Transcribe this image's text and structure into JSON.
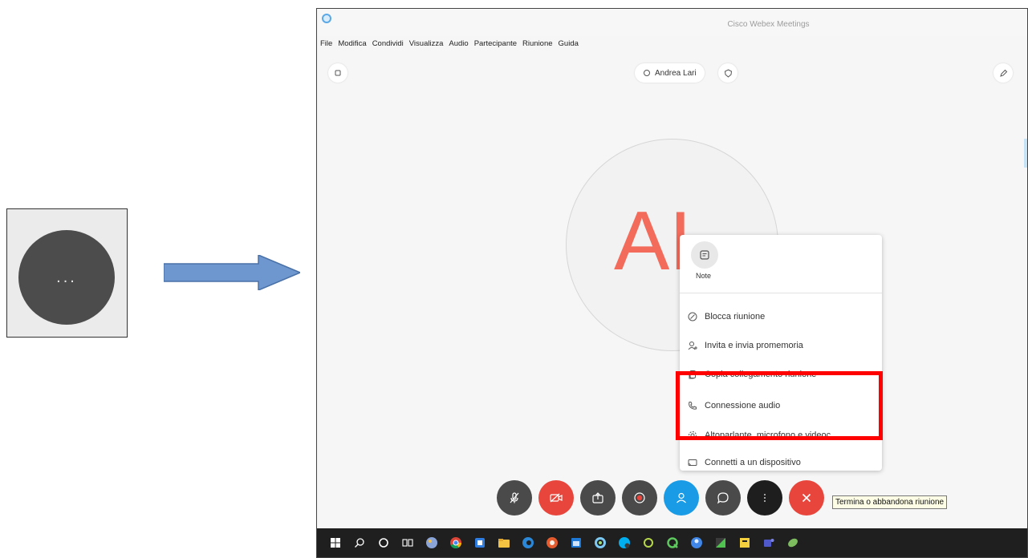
{
  "window": {
    "title": "Cisco Webex Meetings"
  },
  "menubar": [
    "File",
    "Modifica",
    "Condividi",
    "Visualizza",
    "Audio",
    "Partecipante",
    "Riunione",
    "Guida"
  ],
  "host": {
    "name": "Andrea Lari"
  },
  "avatar": {
    "initials": "AL"
  },
  "callout": {
    "glyph": "..."
  },
  "popup": {
    "note_label": "Note",
    "items": [
      {
        "label": "Blocca riunione",
        "icon": "lock-icon"
      },
      {
        "label": "Invita e invia promemoria",
        "icon": "person-add-icon"
      },
      {
        "label": "Copia collegamento riunione",
        "icon": "copy-icon"
      },
      {
        "label": "Connessione audio",
        "icon": "phone-icon"
      },
      {
        "label": "Altoparlante, microfono e videoc...",
        "icon": "gear-icon"
      },
      {
        "label": "Connetti a un dispositivo",
        "icon": "cast-icon"
      }
    ]
  },
  "controls": [
    {
      "name": "mute-button",
      "icon": "microphone-icon",
      "color": "#4a4a4a"
    },
    {
      "name": "video-button",
      "icon": "video-off-icon",
      "color": "#e8453c"
    },
    {
      "name": "share-button",
      "icon": "share-icon",
      "color": "#4a4a4a"
    },
    {
      "name": "record-button",
      "icon": "record-icon",
      "color": "#4a4a4a"
    },
    {
      "name": "participants-button",
      "icon": "person-icon",
      "color": "#1a9be6"
    },
    {
      "name": "chat-button",
      "icon": "chat-icon",
      "color": "#4a4a4a"
    },
    {
      "name": "more-button",
      "icon": "more-icon",
      "color": "#1e1e1e"
    },
    {
      "name": "leave-button",
      "icon": "close-icon",
      "color": "#e8453c"
    }
  ],
  "tooltip": "Termina o abbandona riunione",
  "colors": {
    "highlight": "#ff0000",
    "initials": "#f26b5b",
    "taskbar": "#1f1f1f"
  }
}
